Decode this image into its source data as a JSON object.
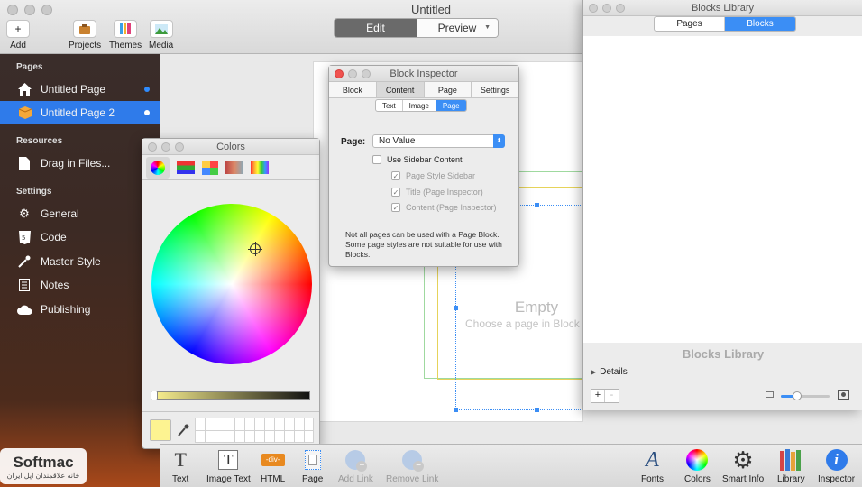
{
  "window": {
    "title": "Untitled"
  },
  "toolbar": {
    "add_label": "Add",
    "projects_label": "Projects",
    "themes_label": "Themes",
    "media_label": "Media",
    "edit_label": "Edit",
    "preview_label": "Preview"
  },
  "sidebar": {
    "pages_header": "Pages",
    "pages": [
      {
        "label": "Untitled Page",
        "selected": false
      },
      {
        "label": "Untitled Page 2",
        "selected": true
      }
    ],
    "resources_header": "Resources",
    "resources": [
      {
        "label": "Drag in Files..."
      }
    ],
    "settings_header": "Settings",
    "settings": [
      {
        "label": "General",
        "icon": "gear-icon"
      },
      {
        "label": "Code",
        "icon": "code-icon"
      },
      {
        "label": "Master Style",
        "icon": "eyedropper-icon"
      },
      {
        "label": "Notes",
        "icon": "notes-icon"
      },
      {
        "label": "Publishing",
        "icon": "cloud-icon"
      }
    ]
  },
  "canvas": {
    "empty_title": "Empty",
    "empty_hint": "Choose a page in Block"
  },
  "colors_panel": {
    "title": "Colors",
    "brightness": 1.0,
    "selected_swatch": "#fdf391"
  },
  "block_inspector": {
    "title": "Block Inspector",
    "tabs": [
      "Block",
      "Content",
      "Page",
      "Settings"
    ],
    "active_tab": "Content",
    "sub_tabs": [
      "Text",
      "Image",
      "Page"
    ],
    "active_sub_tab": "Page",
    "page_label": "Page:",
    "page_value": "No Value",
    "use_sidebar": "Use Sidebar Content",
    "options": [
      "Page Style Sidebar",
      "Title (Page Inspector)",
      "Content (Page Inspector)"
    ],
    "note": "Not all pages can be used with a Page Block.  Some page styles are not suitable for use with Blocks."
  },
  "blocks_library": {
    "title": "Blocks Library",
    "tabs": [
      "Pages",
      "Blocks"
    ],
    "active_tab": "Blocks",
    "heading": "Blocks Library",
    "details_label": "Details",
    "add_label": "+",
    "remove_label": "-"
  },
  "bottombar": {
    "items": [
      {
        "label": "Text",
        "enabled": true
      },
      {
        "label": "Image Text",
        "enabled": true
      },
      {
        "label": "HTML",
        "enabled": true
      },
      {
        "label": "Page",
        "enabled": true
      },
      {
        "label": "Add Link",
        "enabled": false
      },
      {
        "label": "Remove Link",
        "enabled": false
      }
    ],
    "right_items": [
      {
        "label": "Fonts"
      },
      {
        "label": "Colors"
      },
      {
        "label": "Smart Info"
      },
      {
        "label": "Library"
      },
      {
        "label": "Inspector"
      }
    ],
    "html_tag": "-div-"
  },
  "watermark": {
    "brand": "Softmac",
    "tagline": "خانه علاقمندان اپل ایران"
  },
  "colors": {
    "accent": "#2f7bea",
    "selection_blue": "#3b8ef5",
    "guide_green": "#7fd07f",
    "guide_yellow": "#e6d35a"
  }
}
